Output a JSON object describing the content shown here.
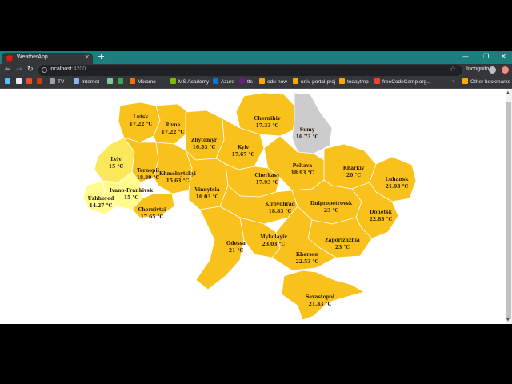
{
  "browser": {
    "tab_title": "WeatherApp",
    "url_host": "localhost",
    "url_port": ":4200",
    "incognito_label": "Incognito",
    "bookmarks": [
      "TV",
      "Internet",
      "Mixamo",
      "MS Academy",
      "Azure",
      "tfs",
      "edu-now",
      "univ-portal-proj",
      "todaytmp",
      "freeCodeCamp.org..."
    ],
    "other_bookmarks": "Other bookmarks"
  },
  "colors": {
    "region_default": "#f9c11b",
    "region_warm_light": "#fbe85a",
    "region_pale": "#fffb8f",
    "region_missing": "#cccccc"
  },
  "regions": [
    {
      "name": "Lutsk",
      "temp": "17.22 °C"
    },
    {
      "name": "Rivne",
      "temp": "17.22 °C"
    },
    {
      "name": "Zhytomyr",
      "temp": "16.53 °C"
    },
    {
      "name": "Chernihiv",
      "temp": "17.33 °C"
    },
    {
      "name": "Sumy",
      "temp": "16.73 °C"
    },
    {
      "name": "Kyiv",
      "temp": "17.67 °C"
    },
    {
      "name": "Lviv",
      "temp": "15 °C"
    },
    {
      "name": "Ternopil",
      "temp": "18.89 °C"
    },
    {
      "name": "Khmelnytskyi",
      "temp": "15.63 °C"
    },
    {
      "name": "Vinnytsia",
      "temp": "16.03 °C"
    },
    {
      "name": "Cherkasy",
      "temp": "17.93 °C"
    },
    {
      "name": "Poltava",
      "temp": "18.93 °C"
    },
    {
      "name": "Kharkiv",
      "temp": "20 °C"
    },
    {
      "name": "Luhansk",
      "temp": "21.93 °C"
    },
    {
      "name": "Ivano-Frankivsk",
      "temp": "15 °C"
    },
    {
      "name": "Uzhhorod",
      "temp": "14.27 °C"
    },
    {
      "name": "Chernivtsi",
      "temp": "17.65 °C"
    },
    {
      "name": "Kirovohrad",
      "temp": "18.83 °C"
    },
    {
      "name": "Dnipropetrovsk",
      "temp": "23 °C"
    },
    {
      "name": "Donetsk",
      "temp": "22.83 °C"
    },
    {
      "name": "Odessa",
      "temp": "21 °C"
    },
    {
      "name": "Mykolayiv",
      "temp": "23.03 °C"
    },
    {
      "name": "Zaporizhzhia",
      "temp": "23 °C"
    },
    {
      "name": "Kherson",
      "temp": "22.53 °C"
    },
    {
      "name": "Sevastopol",
      "temp": "21.33 °C"
    }
  ]
}
